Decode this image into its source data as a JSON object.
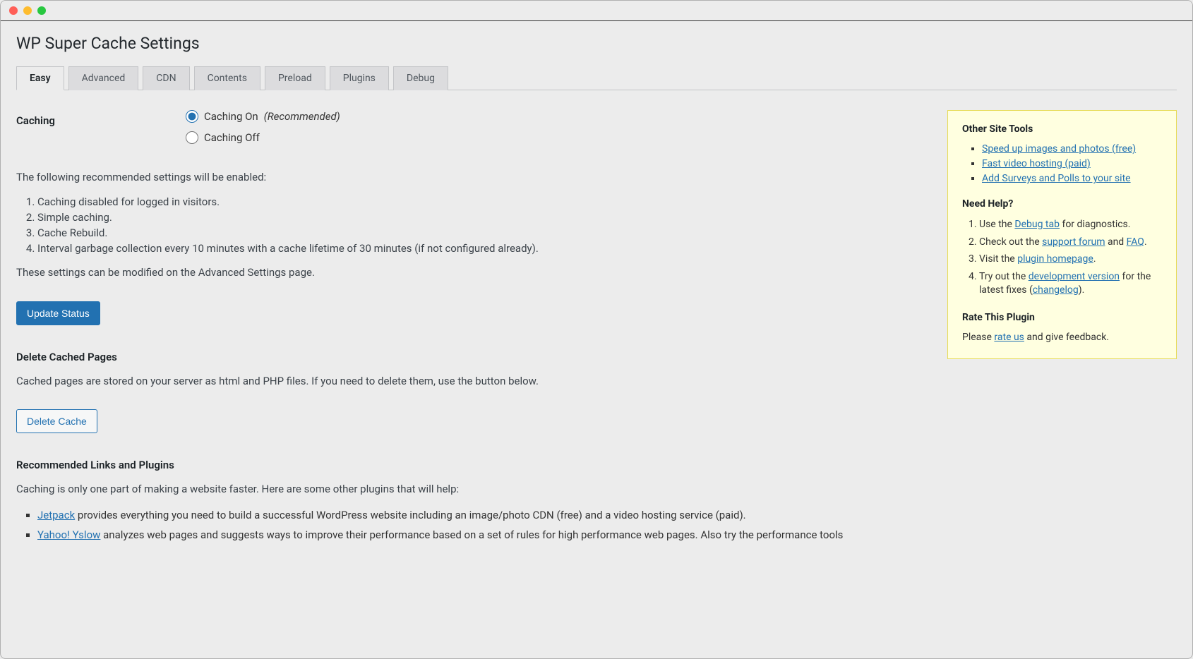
{
  "page_title": "WP Super Cache Settings",
  "tabs": [
    "Easy",
    "Advanced",
    "CDN",
    "Contents",
    "Preload",
    "Plugins",
    "Debug"
  ],
  "active_tab": "Easy",
  "caching": {
    "label": "Caching",
    "on_label": "Caching On",
    "on_suffix": "(Recommended)",
    "off_label": "Caching Off",
    "selected": "on"
  },
  "intro_text": "The following recommended settings will be enabled:",
  "rec_list": [
    "Caching disabled for logged in visitors.",
    "Simple caching.",
    "Cache Rebuild.",
    "Interval garbage collection every 10 minutes with a cache lifetime of 30 minutes (if not configured already)."
  ],
  "mod_text": "These settings can be modified on the Advanced Settings page.",
  "update_btn": "Update Status",
  "delete_section": {
    "heading": "Delete Cached Pages",
    "text": "Cached pages are stored on your server as html and PHP files. If you need to delete them, use the button below.",
    "button": "Delete Cache"
  },
  "rec_links": {
    "heading": "Recommended Links and Plugins",
    "intro": "Caching is only one part of making a website faster. Here are some other plugins that will help:",
    "jetpack_link": "Jetpack",
    "jetpack_text": " provides everything you need to build a successful WordPress website including an image/photo CDN (free) and a video hosting service (paid).",
    "yslow_link": "Yahoo! Yslow",
    "yslow_text": " analyzes web pages and suggests ways to improve their performance based on a set of rules for high performance web pages. Also try the performance tools"
  },
  "sidebar": {
    "tools_head": "Other Site Tools",
    "tools": [
      "Speed up images and photos (free)",
      "Fast video hosting (paid)",
      "Add Surveys and Polls to your site"
    ],
    "help_head": "Need Help?",
    "help1_pre": "Use the ",
    "help1_link": "Debug tab",
    "help1_post": " for diagnostics.",
    "help2_pre": "Check out the ",
    "help2_link": "support forum",
    "help2_mid": " and ",
    "help2_link2": "FAQ",
    "help2_post": ".",
    "help3_pre": "Visit the ",
    "help3_link": "plugin homepage",
    "help3_post": ".",
    "help4_pre": "Try out the ",
    "help4_link": "development version",
    "help4_mid": " for the latest fixes (",
    "help4_link2": "changelog",
    "help4_post": ").",
    "rate_head": "Rate This Plugin",
    "rate_pre": "Please ",
    "rate_link": "rate us",
    "rate_post": " and give feedback."
  }
}
